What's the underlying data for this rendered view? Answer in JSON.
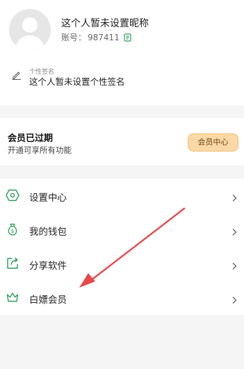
{
  "profile": {
    "nickname": "这个人暂未设置昵称",
    "account_label": "账号：",
    "account_id": "987411",
    "signature_label": "个性签名",
    "signature": "这个人暂未设置个性签名"
  },
  "membership": {
    "title": "会员已过期",
    "subtitle": "开通可享所有功能",
    "button_label": "会员中心",
    "button_color": "#fbd9a6"
  },
  "menu": {
    "items": [
      {
        "label": "设置中心",
        "icon": "settings-hexagon-icon"
      },
      {
        "label": "我的钱包",
        "icon": "wallet-money-bag-icon"
      },
      {
        "label": "分享软件",
        "icon": "share-icon"
      },
      {
        "label": "白嫖会员",
        "icon": "crown-icon"
      }
    ]
  },
  "colors": {
    "accent_green": "#2e9a5a",
    "annotation_red": "#e8484c",
    "background": "#f5f5f5"
  }
}
